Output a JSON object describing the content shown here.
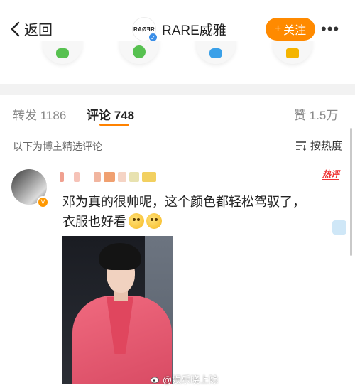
{
  "header": {
    "back_label": "返回",
    "account_logo_text": "RAØƎR",
    "account_name": "RARE威雅",
    "follow_label": "关注",
    "follow_plus": "+",
    "more_label": "•••"
  },
  "tabs": {
    "repost": {
      "label": "转发",
      "count": "1186"
    },
    "comment": {
      "label": "评论",
      "count": "748"
    },
    "like": {
      "label": "赞",
      "count": "1.5万"
    }
  },
  "comments_section": {
    "title": "以下为博主精选评论",
    "sort_label": "按热度"
  },
  "comment": {
    "hot_tag": "热评",
    "text_line1": "邓为真的很帅呢，这个颜色都轻松驾驭了，",
    "text_line2": "衣服也好看"
  },
  "watermark": "@娱乐晓上除",
  "colors": {
    "accent_orange": "#ff8a00",
    "tab_underline": "#ff8200",
    "hot_red": "#e33333",
    "verified_blue": "#3b8fe8"
  }
}
